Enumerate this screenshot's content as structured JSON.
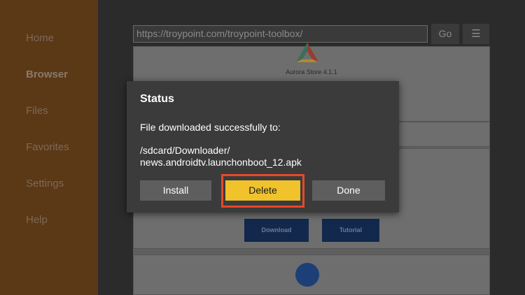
{
  "sidebar": {
    "items": [
      {
        "label": "Home"
      },
      {
        "label": "Browser"
      },
      {
        "label": "Files"
      },
      {
        "label": "Favorites"
      },
      {
        "label": "Settings"
      },
      {
        "label": "Help"
      }
    ]
  },
  "toolbar": {
    "url": "https://troypoint.com/troypoint-toolbox/",
    "go_label": "Go",
    "menu_glyph": "☰"
  },
  "webpage": {
    "app_title": "Aurora Store 4.1.1",
    "download_label": "Download",
    "tutorial_label": "Tutorial"
  },
  "dialog": {
    "title": "Status",
    "message": "File downloaded successfully to:",
    "path_line1": "/sdcard/Downloader/",
    "path_line2": "news.androidtv.launchonboot_12.apk",
    "buttons": {
      "install": "Install",
      "delete": "Delete",
      "done": "Done"
    }
  },
  "colors": {
    "sidebar_bg": "#5b3816",
    "dialog_bg": "#3b3b3b",
    "delete_button": "#f0c22c",
    "highlight_border": "#e8482a"
  },
  "icons": {
    "menu": "hamburger-menu-icon",
    "app_logo": "aurora-store-logo"
  }
}
